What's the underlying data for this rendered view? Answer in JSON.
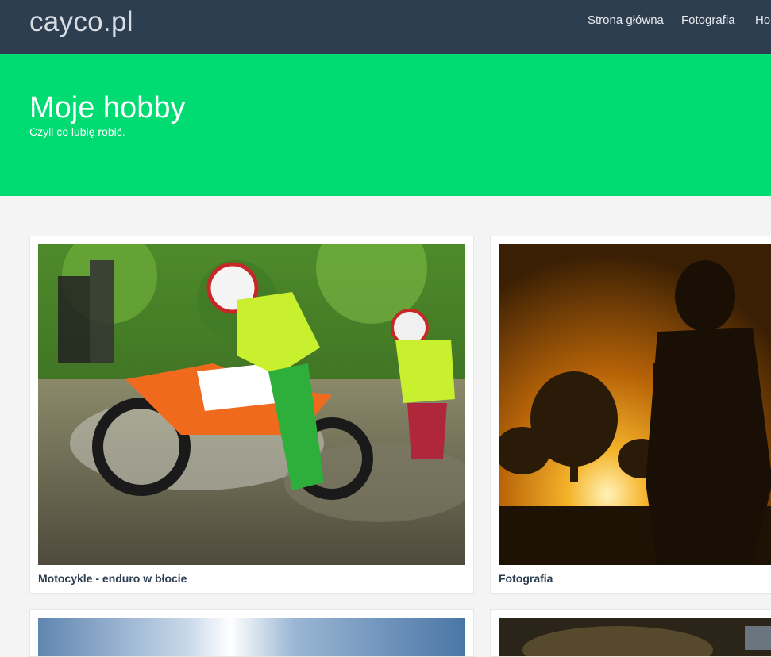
{
  "nav": {
    "brand": "cayco.pl",
    "links": [
      "Strona główna",
      "Fotografia",
      "Ho"
    ]
  },
  "hero": {
    "title": "Moje hobby",
    "subtitle": "Czyli co lubię robić."
  },
  "cards": [
    {
      "caption": "Motocykle - enduro w błocie",
      "image": "enduro-motorcycle-mud-photo"
    },
    {
      "caption": "Fotografia",
      "image": "photographer-silhouette-sunset-photo"
    },
    {
      "caption": "",
      "image": "sky-sun-photo"
    },
    {
      "caption": "",
      "image": "dark-photo"
    }
  ]
}
